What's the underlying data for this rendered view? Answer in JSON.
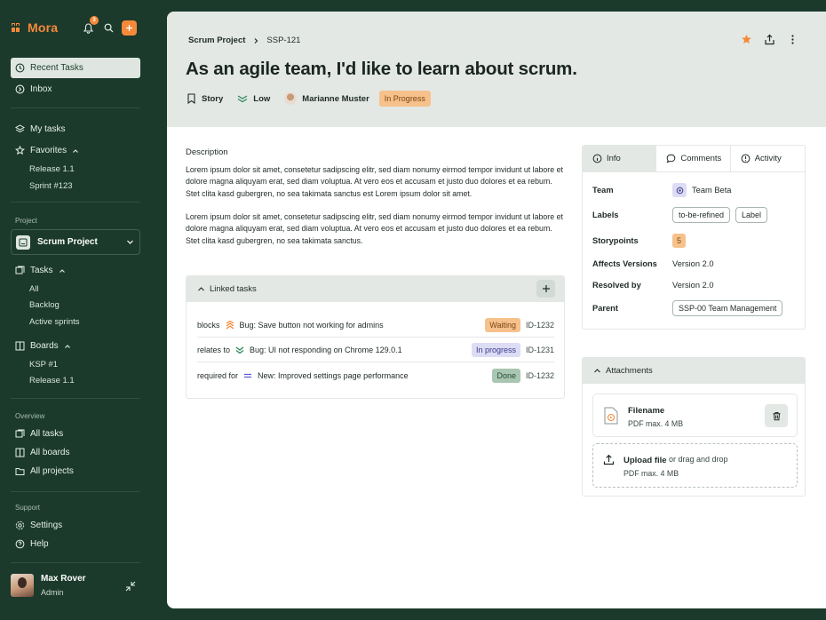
{
  "brand": {
    "name": "Mora",
    "color": "#f5893a"
  },
  "topbar": {
    "notification_count": "3"
  },
  "sidebar": {
    "recent_tasks": "Recent Tasks",
    "inbox": "Inbox",
    "my_tasks": "My tasks",
    "favorites": "Favorites",
    "favorite_items": [
      "Release 1.1",
      "Sprint #123"
    ],
    "project_label": "Project",
    "project_name": "Scrum Project",
    "tasks": "Tasks",
    "task_items": [
      "All",
      "Backlog",
      "Active sprints"
    ],
    "boards": "Boards",
    "board_items": [
      "KSP #1",
      "Release 1.1"
    ],
    "overview_label": "Overview",
    "overview_items": [
      "All tasks",
      "All boards",
      "All projects"
    ],
    "support_label": "Support",
    "support_items": [
      "Settings",
      "Help"
    ]
  },
  "user": {
    "name": "Max Rover",
    "role": "Admin"
  },
  "breadcrumb": {
    "project": "Scrum Project",
    "issue": "SSP-121"
  },
  "issue": {
    "title": "As an agile team, I'd like to learn about scrum.",
    "type": "Story",
    "priority": "Low",
    "assignee": "Marianne Muster",
    "status": "In Progress"
  },
  "description": {
    "label": "Description",
    "paragraphs": [
      "Lorem ipsum dolor sit amet, consetetur sadipscing elitr, sed diam nonumy eirmod tempor invidunt ut labore et dolore magna aliquyam erat, sed diam voluptua. At vero eos et accusam et justo duo dolores et ea rebum. Stet clita kasd gubergren, no sea takimata sanctus est Lorem ipsum dolor sit amet.",
      "Lorem ipsum dolor sit amet, consetetur sadipscing elitr, sed diam nonumy eirmod tempor invidunt ut labore et dolore magna aliquyam erat, sed diam voluptua. At vero eos et accusam et justo duo dolores et ea rebum. Stet clita kasd gubergren, no sea takimata sanctus."
    ]
  },
  "linked": {
    "title": "Linked tasks",
    "rows": [
      {
        "relation": "blocks",
        "name": "Bug: Save button not working for admins",
        "status": "Waiting",
        "id": "ID-1232"
      },
      {
        "relation": "relates to",
        "name": "Bug: UI not responding on Chrome 129.0.1",
        "status": "In progress",
        "id": "ID-1231"
      },
      {
        "relation": "required for",
        "name": "New: Improved settings page performance",
        "status": "Done",
        "id": "ID-1232"
      }
    ]
  },
  "tabs": [
    "Info",
    "Comments",
    "Activity"
  ],
  "info": {
    "team_key": "Team",
    "team": "Team Beta",
    "labels_key": "Labels",
    "labels": [
      "to-be-refined",
      "Label"
    ],
    "storypoints_key": "Storypoints",
    "storypoints": "5",
    "affects_key": "Affects Versions",
    "affects": "Version 2.0",
    "resolved_key": "Resolved by",
    "resolved": "Version 2.0",
    "parent_key": "Parent",
    "parent": "SSP-00 Team Management"
  },
  "attachments": {
    "title": "Attachments",
    "file_name": "Filename",
    "file_sub": "PDF max. 4 MB",
    "upload_title": "Upload file",
    "upload_or": "or drag and drop",
    "upload_sub": "PDF max. 4 MB"
  }
}
